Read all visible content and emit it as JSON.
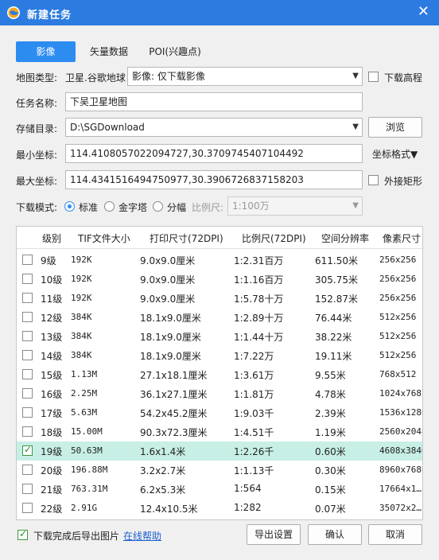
{
  "window": {
    "title": "新建任务",
    "icon": "globe-icon",
    "close": "✕"
  },
  "tabs": [
    {
      "label": "影像",
      "active": true
    },
    {
      "label": "矢量数据",
      "active": false
    },
    {
      "label": "POI(兴趣点)",
      "active": false
    }
  ],
  "map_type": {
    "label": "地图类型:",
    "value": "卫星.谷歌地球",
    "download_mode_value": "影像: 仅下载影像",
    "elevation_label": "下载高程",
    "elevation_checked": false
  },
  "task_name": {
    "label": "任务名称:",
    "value": "下吴卫星地图"
  },
  "storage": {
    "label": "存储目录:",
    "value": "D:\\SGDownload",
    "browse_label": "浏览"
  },
  "min_coord": {
    "label": "最小坐标:",
    "value": "114.4108057022094727,30.3709745407104492",
    "format_label": "坐标格式▼"
  },
  "max_coord": {
    "label": "最大坐标:",
    "value": "114.4341516494750977,30.3906726837158203",
    "outer_rect_label": "外接矩形",
    "outer_rect_checked": false
  },
  "download_mode": {
    "label": "下载模式:",
    "options": [
      {
        "label": "标准",
        "selected": true
      },
      {
        "label": "金字塔",
        "selected": false
      },
      {
        "label": "分幅",
        "selected": false
      }
    ],
    "scale_label": "比例尺:",
    "scale_value": "1:100万"
  },
  "table": {
    "headers": [
      "级别",
      "TIF文件大小",
      "打印尺寸(72DPI)",
      "比例尺(72DPI)",
      "空间分辨率",
      "像素尺寸"
    ],
    "rows": [
      {
        "level": "9级",
        "size": "192K",
        "print": "9.0x9.0厘米",
        "scale": "1:2.31百万",
        "res": "611.50米",
        "pixels": "256x256",
        "checked": false,
        "selected": false
      },
      {
        "level": "10级",
        "size": "192K",
        "print": "9.0x9.0厘米",
        "scale": "1:1.16百万",
        "res": "305.75米",
        "pixels": "256x256",
        "checked": false,
        "selected": false
      },
      {
        "level": "11级",
        "size": "192K",
        "print": "9.0x9.0厘米",
        "scale": "1:5.78十万",
        "res": "152.87米",
        "pixels": "256x256",
        "checked": false,
        "selected": false
      },
      {
        "level": "12级",
        "size": "384K",
        "print": "18.1x9.0厘米",
        "scale": "1:2.89十万",
        "res": "76.44米",
        "pixels": "512x256",
        "checked": false,
        "selected": false
      },
      {
        "level": "13级",
        "size": "384K",
        "print": "18.1x9.0厘米",
        "scale": "1:1.44十万",
        "res": "38.22米",
        "pixels": "512x256",
        "checked": false,
        "selected": false
      },
      {
        "level": "14级",
        "size": "384K",
        "print": "18.1x9.0厘米",
        "scale": "1:7.22万",
        "res": "19.11米",
        "pixels": "512x256",
        "checked": false,
        "selected": false
      },
      {
        "level": "15级",
        "size": "1.13M",
        "print": "27.1x18.1厘米",
        "scale": "1:3.61万",
        "res": "9.55米",
        "pixels": "768x512",
        "checked": false,
        "selected": false
      },
      {
        "level": "16级",
        "size": "2.25M",
        "print": "36.1x27.1厘米",
        "scale": "1:1.81万",
        "res": "4.78米",
        "pixels": "1024x768",
        "checked": false,
        "selected": false
      },
      {
        "level": "17级",
        "size": "5.63M",
        "print": "54.2x45.2厘米",
        "scale": "1:9.03千",
        "res": "2.39米",
        "pixels": "1536x1280",
        "checked": false,
        "selected": false
      },
      {
        "level": "18级",
        "size": "15.00M",
        "print": "90.3x72.3厘米",
        "scale": "1:4.51千",
        "res": "1.19米",
        "pixels": "2560x2048",
        "checked": false,
        "selected": false
      },
      {
        "level": "19级",
        "size": "50.63M",
        "print": "1.6x1.4米",
        "scale": "1:2.26千",
        "res": "0.60米",
        "pixels": "4608x3840",
        "checked": true,
        "selected": true
      },
      {
        "level": "20级",
        "size": "196.88M",
        "print": "3.2x2.7米",
        "scale": "1:1.13千",
        "res": "0.30米",
        "pixels": "8960x7680",
        "checked": false,
        "selected": false
      },
      {
        "level": "21级",
        "size": "763.31M",
        "print": "6.2x5.3米",
        "scale": "1:564",
        "res": "0.15米",
        "pixels": "17664x1…",
        "checked": false,
        "selected": false
      },
      {
        "level": "22级",
        "size": "2.91G",
        "print": "12.4x10.5米",
        "scale": "1:282",
        "res": "0.07米",
        "pixels": "35072x2…",
        "checked": false,
        "selected": false
      }
    ]
  },
  "footer": {
    "export_after_label": "下载完成后导出图片",
    "export_after_checked": true,
    "help_label": "在线帮助",
    "export_settings_label": "导出设置",
    "ok_label": "确认",
    "cancel_label": "取消"
  },
  "colors": {
    "titlebar": "#2b7be0",
    "tab_active": "#2d8cf0",
    "row_selected": "#c7efe6",
    "link": "#1a5fd0"
  }
}
